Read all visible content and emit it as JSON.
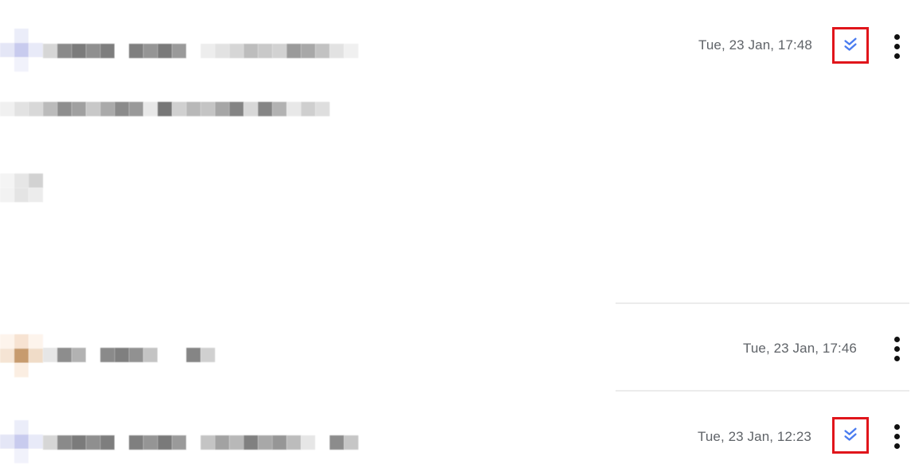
{
  "emails": [
    {
      "timestamp": "Tue, 23 Jan, 17:48",
      "done_marked": true,
      "done_icon": "double-check-icon",
      "more_icon": "more-vert-icon"
    },
    {
      "timestamp": "Tue, 23 Jan, 17:46",
      "done_marked": false,
      "more_icon": "more-vert-icon"
    },
    {
      "timestamp": "Tue, 23 Jan, 12:23",
      "done_marked": true,
      "done_icon": "double-check-icon",
      "more_icon": "more-vert-icon"
    }
  ],
  "colors": {
    "done_icon": "#4a7cf0",
    "highlight_border": "#e0151b",
    "timestamp_text": "#5f6368"
  }
}
